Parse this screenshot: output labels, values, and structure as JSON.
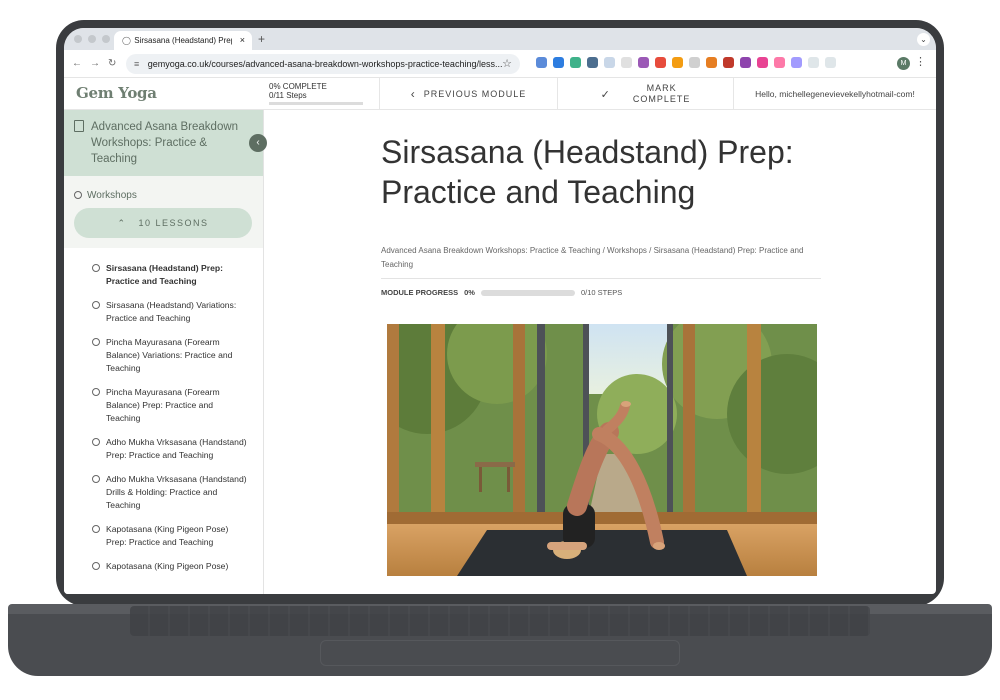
{
  "browser": {
    "tab_title": "Sirsasana (Headstand) Prep:",
    "tab_close": "×",
    "new_tab": "+",
    "url": "gemyoga.co.uk/courses/advanced-asana-breakdown-workshops-practice-teaching/less...",
    "avatar_initial": "M"
  },
  "header": {
    "logo": "Gem Yoga",
    "progress_percent_label": "0% COMPLETE",
    "progress_steps_label": "0/11 Steps",
    "prev_label": "PREVIOUS MODULE",
    "mark_label_1": "MARK",
    "mark_label_2": "COMPLETE",
    "greeting": "Hello, michellegenevievekellyhotmail-com!"
  },
  "sidebar": {
    "course_title": "Advanced Asana Breakdown Workshops: Practice & Teaching",
    "section_label": "Workshops",
    "lessons_label": "10 LESSONS",
    "lessons": [
      "Sirsasana (Headstand) Prep: Practice and Teaching",
      "Sirsasana (Headstand) Variations: Practice and Teaching",
      "Pincha Mayurasana (Forearm Balance) Variations: Practice and Teaching",
      "Pincha Mayurasana (Forearm Balance) Prep: Practice and Teaching",
      "Adho Mukha Vrksasana (Handstand) Prep: Practice and Teaching",
      "Adho Mukha Vrksasana (Handstand) Drills & Holding: Practice and Teaching",
      "Kapotasana (King Pigeon Pose) Prep: Practice and Teaching",
      "Kapotasana (King Pigeon Pose)"
    ]
  },
  "main": {
    "title": "Sirsasana (Headstand) Prep: Practice and Teaching",
    "breadcrumb": "Advanced Asana Breakdown Workshops: Practice & Teaching  /  Workshops  /  Sirsasana (Headstand) Prep: Practice and Teaching",
    "module_progress_label": "MODULE PROGRESS",
    "module_progress_pct": "0%",
    "module_progress_steps": "0/10 STEPS",
    "module_progress_value": 0
  },
  "colors": {
    "sage": "#cfe0d4",
    "sage_dark": "#5e6e62",
    "bezel": "#3a3c3f"
  }
}
